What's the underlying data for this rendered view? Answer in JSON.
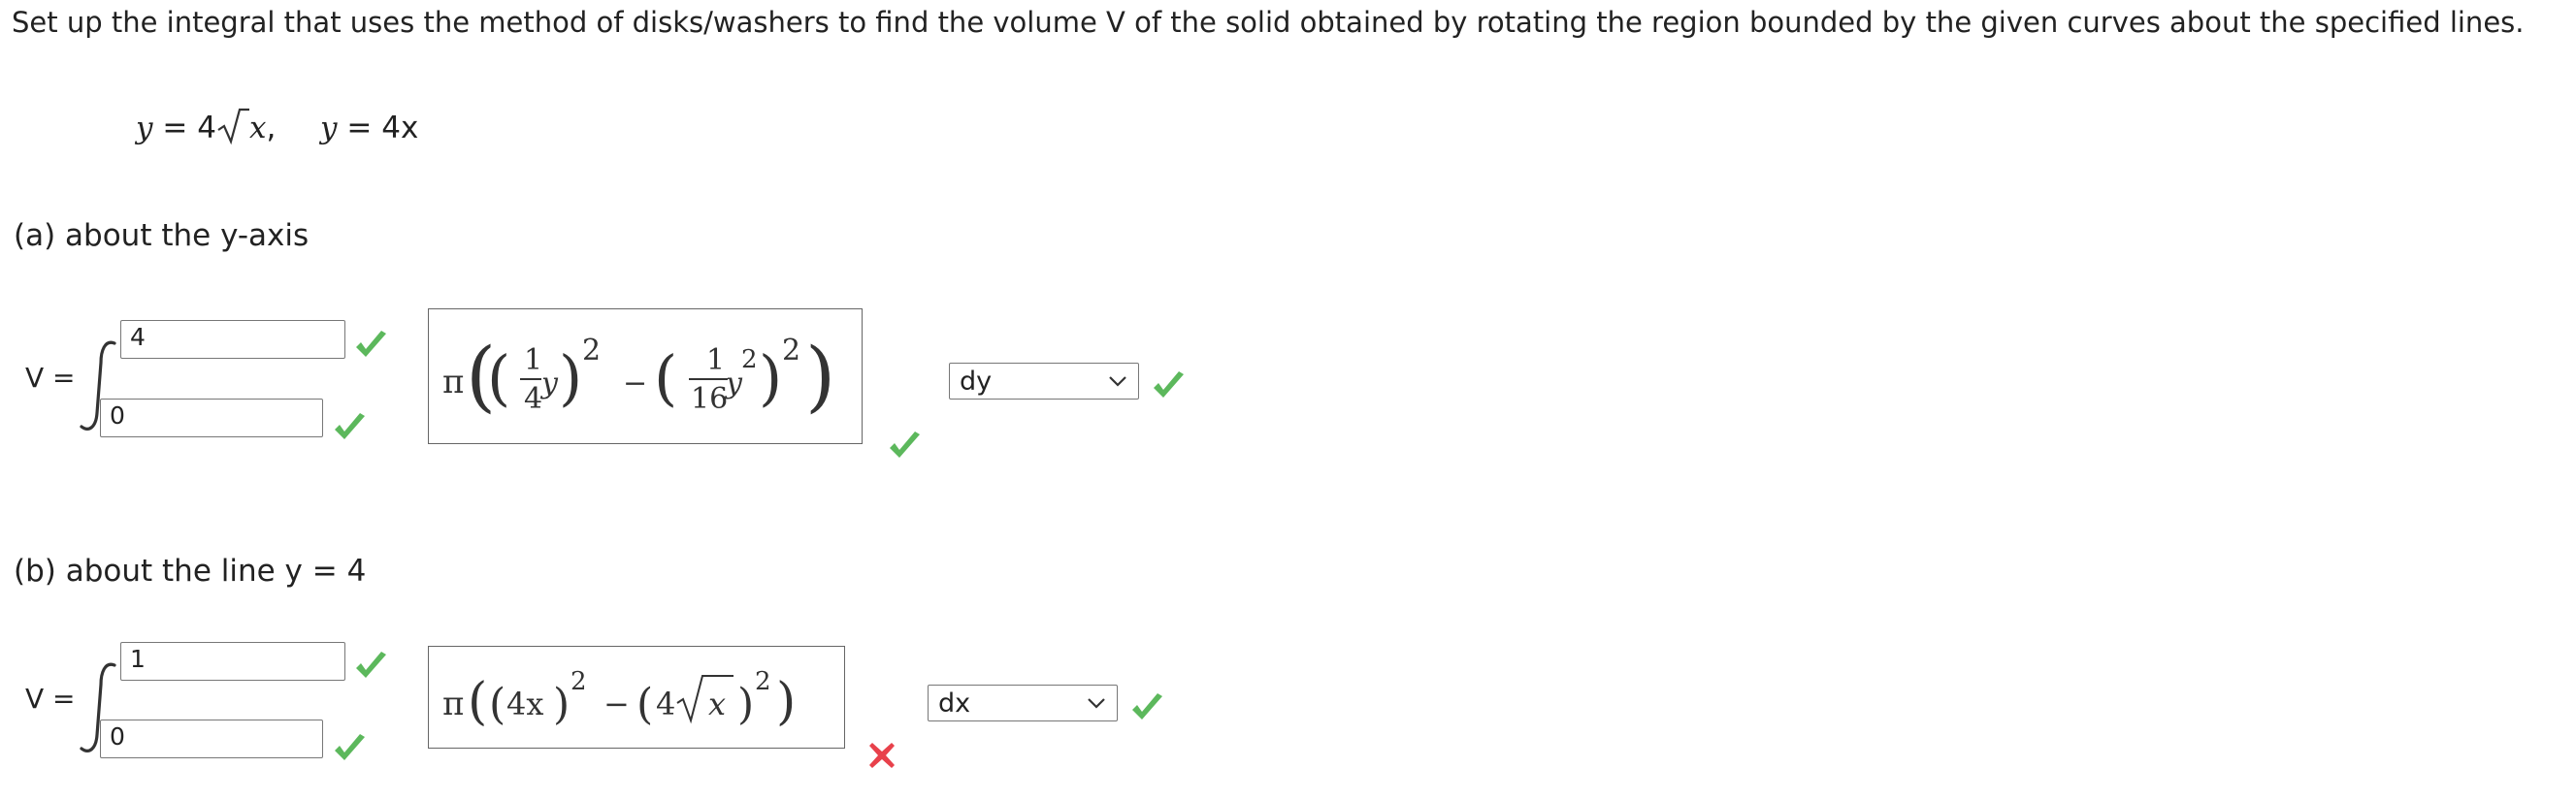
{
  "prompt": "Set up the integral that uses the method of disks/washers to find the volume V of the solid obtained by rotating the region bounded by the given curves about the specified lines.",
  "given": {
    "curve1_lhs": "y",
    "curve1_rhs_coef": "4",
    "curve1_radicand": "x",
    "sep": ",",
    "curve2_lhs": "y",
    "curve2_rhs": "4x"
  },
  "parts": [
    {
      "label": "(a) about the y-axis",
      "veq": "V =",
      "upper_limit": "4",
      "lower_limit": "0",
      "integrand": {
        "pi": "π",
        "frac1_num": "1",
        "frac1_den": "4",
        "var1": "y",
        "exp1": "2",
        "minus": "−",
        "frac2_num": "1",
        "frac2_den": "16",
        "var2": "y",
        "inner_exp2": "2",
        "exp2": "2"
      },
      "integrand_status": "correct",
      "differential": "dy",
      "upper_status": "correct",
      "lower_status": "correct",
      "differential_status": "correct"
    },
    {
      "label": "(b) about the line y = 4",
      "veq": "V =",
      "upper_limit": "1",
      "lower_limit": "0",
      "integrand": {
        "pi": "π",
        "term1": "4x",
        "exp1": "2",
        "minus": "−",
        "coef2": "4",
        "radicand2": "x",
        "exp2": "2"
      },
      "integrand_status": "incorrect",
      "differential": "dx",
      "upper_status": "correct",
      "lower_status": "correct",
      "differential_status": "correct"
    }
  ],
  "colors": {
    "check": "#5cb85c",
    "cross": "#e8414b",
    "input_border": "#777777",
    "text": "#222222"
  },
  "icons": {
    "correct": "check-icon",
    "incorrect": "x-icon",
    "dropdown": "chevron-down-icon"
  }
}
